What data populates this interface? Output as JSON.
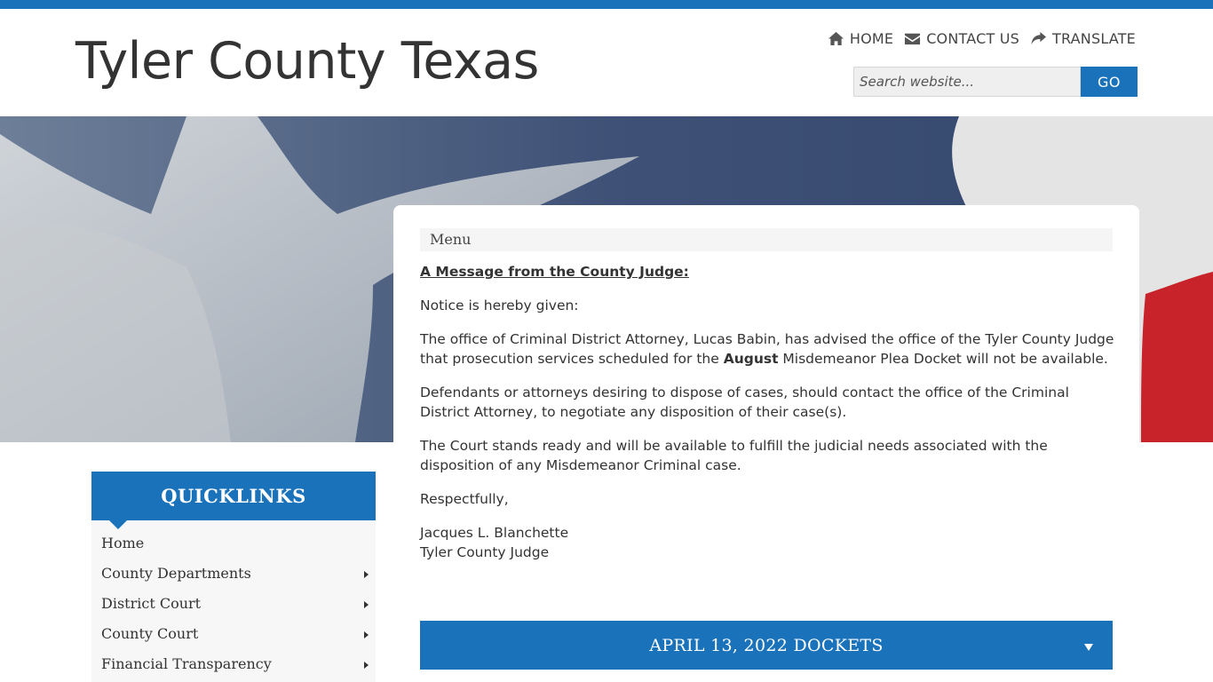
{
  "brand": {
    "primary": "#1a72bb"
  },
  "header": {
    "site_title": "Tyler County Texas",
    "links": [
      {
        "label": "HOME",
        "icon": "home-icon"
      },
      {
        "label": "CONTACT US",
        "icon": "envelope-icon"
      },
      {
        "label": "TRANSLATE",
        "icon": "share-icon"
      }
    ],
    "search": {
      "placeholder": "Search website...",
      "button": "GO"
    }
  },
  "content": {
    "menu_label": "Menu",
    "heading": "A Message from the County Judge:",
    "p1": "Notice is hereby given:",
    "p2_a": "The office of Criminal District Attorney, Lucas Babin, has advised the office of the Tyler County Judge that prosecution services scheduled for the ",
    "p2_bold": "August",
    "p2_b": " Misdemeanor Plea Docket will not be available.",
    "p3": "Defendants or attorneys desiring to dispose of cases, should contact the office of the Criminal District Attorney, to negotiate any disposition of their case(s).",
    "p4": "The Court stands ready and will be available to fulfill the judicial needs associated with the disposition of any Misdemeanor Criminal case.",
    "p5": "Respectfully,",
    "sig_name": "Jacques L. Blanchette",
    "sig_title": "Tyler County Judge",
    "docket_title": "APRIL 13, 2022 DOCKETS"
  },
  "quicklinks": {
    "title": "QUICKLINKS",
    "items": [
      {
        "label": "Home"
      },
      {
        "label": "County Departments"
      },
      {
        "label": "District Court"
      },
      {
        "label": "County Court"
      },
      {
        "label": "Financial Transparency"
      }
    ]
  }
}
